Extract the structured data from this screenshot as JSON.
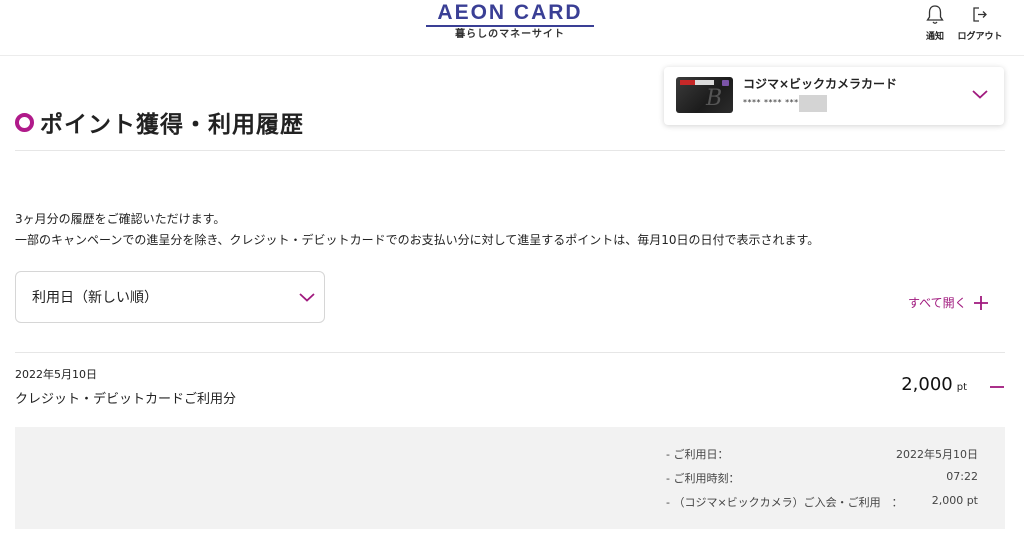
{
  "header": {
    "logo_text": "AEON CARD",
    "logo_sub": "暮らしのマネーサイト",
    "notice_label": "通知",
    "logout_label": "ログアウト"
  },
  "page": {
    "title": "ポイント獲得・利用履歴"
  },
  "card": {
    "name": "コジマ×ビックカメラカード",
    "number": "**** **** ****"
  },
  "info": {
    "line1": "3ヶ月分の履歴をご確認いただけます。",
    "line2": "一部のキャンペーンでの進呈分を除き、クレジット・デビットカードでのお支払い分に対して進呈するポイントは、毎月10日の日付で表示されます。"
  },
  "sort": {
    "selected": "利用日（新しい順）"
  },
  "open_all_label": "すべて開く",
  "entries": [
    {
      "date": "2022年5月10日",
      "title": "クレジット・デビットカードご利用分",
      "amount": "2,000",
      "unit": "pt",
      "details": [
        {
          "label": "- ご利用日：",
          "value": "2022年5月10日"
        },
        {
          "label": "- ご利用時刻：",
          "value": "07:22"
        },
        {
          "label": "- （コジマ×ビックカメラ）ご入会・ご利用　：",
          "value": "2,000 pt"
        }
      ]
    }
  ],
  "colors": {
    "accent": "#a0197e",
    "brand": "#3a3f95",
    "panel": "#f2f2f2"
  },
  "icons": {
    "notice": "bell-icon",
    "logout": "logout-icon",
    "dropdown": "chevron-down-icon",
    "expand": "plus-icon",
    "collapse": "minus-icon",
    "title_marker": "ring-icon"
  }
}
